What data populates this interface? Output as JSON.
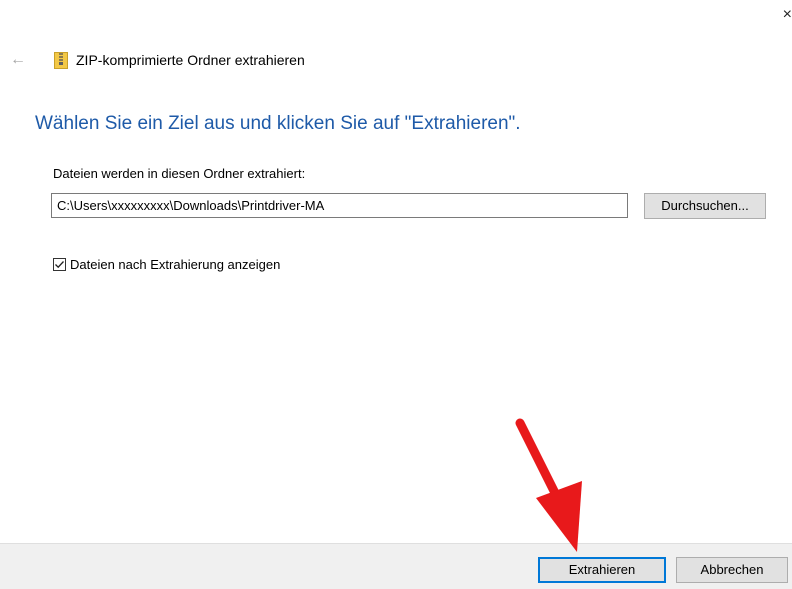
{
  "dialog": {
    "close_glyph": "×",
    "back_glyph": "←",
    "title": "ZIP-komprimierte Ordner extrahieren",
    "instruction": "Wählen Sie ein Ziel aus und klicken Sie auf \"Extrahieren\".",
    "folder_label": "Dateien werden in diesen Ordner extrahiert:",
    "path_value": "C:\\Users\\xxxxxxxxx\\Downloads\\Printdriver-MA",
    "browse_label": "Durchsuchen...",
    "show_after_label": "Dateien nach Extrahierung anzeigen",
    "show_after_checked": true
  },
  "footer": {
    "extract_label": "Extrahieren",
    "cancel_label": "Abbrechen"
  },
  "icons": {
    "zip": "zip-folder-icon",
    "back": "back-arrow-icon",
    "close": "close-icon",
    "check": "checkmark-icon",
    "annotation": "red-arrow-annotation"
  },
  "colors": {
    "accent": "#0078d7",
    "instruction_text": "#1e5aa8",
    "footer_bg": "#f0f0f0",
    "button_bg": "#e1e1e1",
    "annotation_arrow": "#e8191b"
  }
}
